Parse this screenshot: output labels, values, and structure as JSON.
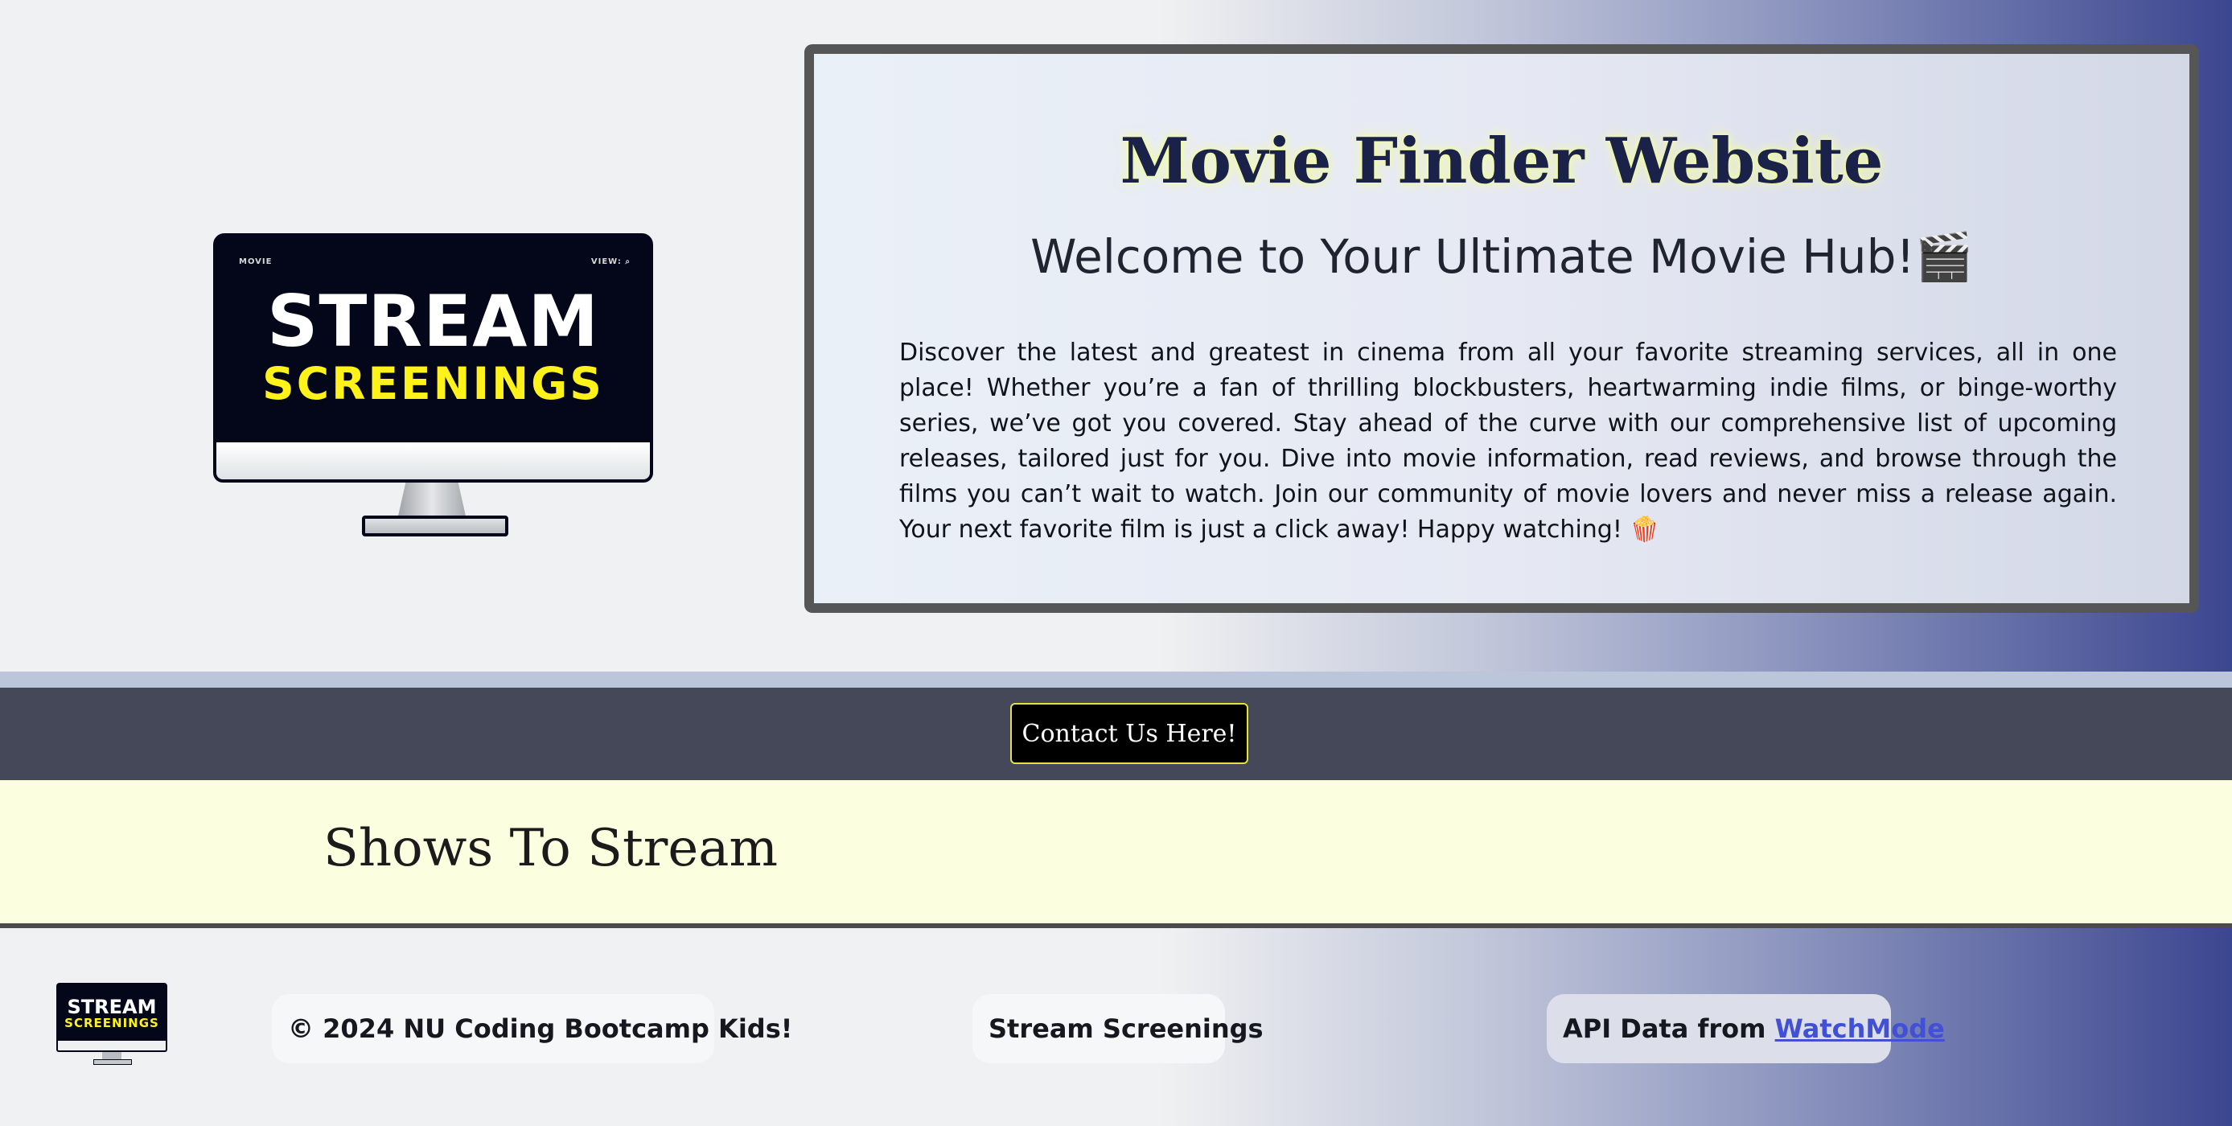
{
  "logo": {
    "menu_left": "MOVIE",
    "menu_right": "VIEW: ⌕",
    "word_top": "STREAM",
    "word_bottom": "SCREENINGS"
  },
  "hero": {
    "title": "Movie Finder Website",
    "subtitle": "Welcome to Your Ultimate Movie Hub!🎬",
    "body": "Discover the latest and greatest in cinema from all your favorite streaming services, all in one place! Whether you’re a fan of thrilling blockbusters, heartwarming indie films, or binge-worthy series, we’ve got you covered. Stay ahead of the curve with our comprehensive list of upcoming releases, tailored just for you. Dive into movie information, read reviews, and browse through the films you can’t wait to watch. Join our community of movie lovers and never miss a release again. Your next favorite film is just a click away! Happy watching! 🍿"
  },
  "contact": {
    "label": "Contact Us Here!"
  },
  "shows": {
    "heading": "Shows To Stream"
  },
  "footer": {
    "copyright": "© 2024 NU Coding Bootcamp Kids!",
    "brand": "Stream Screenings",
    "api_prefix": "API Data from ",
    "api_link": "WatchMode"
  },
  "colors": {
    "accent_yellow": "#fff21a",
    "contact_bar": "#444858",
    "shows_bar": "#fbfedf",
    "link": "#4250d6"
  }
}
